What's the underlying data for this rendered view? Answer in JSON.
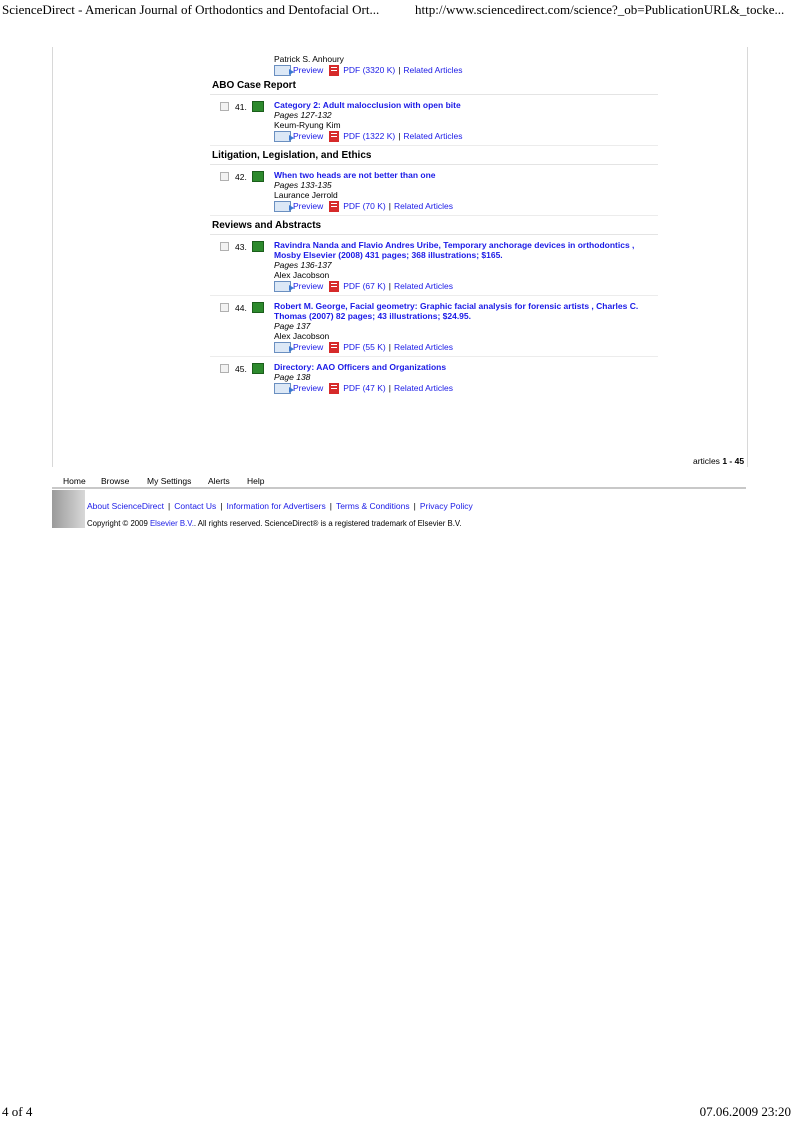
{
  "print_header": {
    "left": "ScienceDirect - American Journal of Orthodontics and Dentofacial Ort...",
    "right": "http://www.sciencedirect.com/science?_ob=PublicationURL&_tocke..."
  },
  "print_footer": {
    "page": "4 of 4",
    "datetime": "07.06.2009 23:20"
  },
  "continued_article": {
    "author": "Patrick S. Anhoury",
    "preview_label": "Preview",
    "pdf_label": "PDF (3320 K)",
    "related_label": "Related Articles"
  },
  "sections": [
    {
      "title": "ABO Case Report",
      "articles": [
        {
          "number": "41.",
          "title": "Category 2: Adult malocclusion with open bite",
          "pages": "Pages 127-132",
          "author": "Keum-Ryung Kim",
          "preview": "Preview",
          "pdf": "PDF (1322 K)",
          "related": "Related Articles"
        }
      ]
    },
    {
      "title": "Litigation, Legislation, and Ethics",
      "articles": [
        {
          "number": "42.",
          "title": "When two heads are not better than one",
          "pages": "Pages 133-135",
          "author": "Laurance Jerrold",
          "preview": "Preview",
          "pdf": "PDF (70 K)",
          "related": "Related Articles"
        }
      ]
    },
    {
      "title": "Reviews and Abstracts",
      "articles": [
        {
          "number": "43.",
          "title": "Ravindra Nanda and Flavio Andres Uribe, Temporary anchorage devices in orthodontics , Mosby Elsevier (2008) 431 pages; 368 illustrations; $165.",
          "pages": "Pages 136-137",
          "author": "Alex Jacobson",
          "preview": "Preview",
          "pdf": "PDF (67 K)",
          "related": "Related Articles"
        },
        {
          "number": "44.",
          "title": "Robert M. George, Facial geometry: Graphic facial analysis for forensic artists , Charles C. Thomas (2007) 82 pages; 43 illustrations; $24.95.",
          "pages": "Page 137",
          "author": "Alex Jacobson",
          "preview": "Preview",
          "pdf": "PDF (55 K)",
          "related": "Related Articles"
        },
        {
          "number": "45.",
          "title": "Directory: AAO Officers and Organizations",
          "pages": "Page 138",
          "author": "",
          "preview": "Preview",
          "pdf": "PDF (47 K)",
          "related": "Related Articles"
        }
      ]
    }
  ],
  "articles_count": {
    "prefix": "articles",
    "range": "1 - 45"
  },
  "nav": [
    "Home",
    "Browse",
    "My Settings",
    "Alerts",
    "Help"
  ],
  "footer_links": [
    "About ScienceDirect",
    "Contact Us",
    "Information for Advertisers",
    "Terms & Conditions",
    "Privacy Policy"
  ],
  "copyright": {
    "pre": "Copyright © 2009",
    "company": "Elsevier B.V.",
    "post": "All rights reserved. ScienceDirect® is a registered trademark of Elsevier B.V."
  }
}
